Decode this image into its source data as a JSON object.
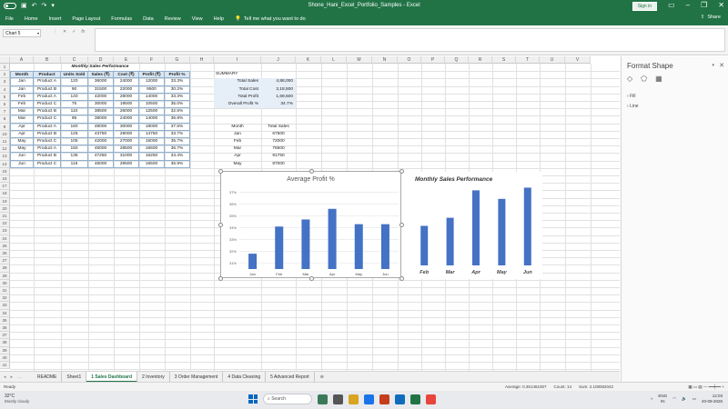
{
  "window": {
    "autosave_label": "AutoSave",
    "title": "Shone_Hani_Excel_Portfolio_Samples - Excel",
    "signin_label": "Sign in",
    "colors": {
      "accent": "#217346",
      "chart_bar": "#4472c4"
    }
  },
  "ribbon": {
    "tabs": [
      "File",
      "Home",
      "Insert",
      "Page Layout",
      "Formulas",
      "Data",
      "Review",
      "View",
      "Help"
    ],
    "tell_me": "Tell me what you want to do",
    "share": "Share"
  },
  "formula_bar": {
    "name_box": "Chart 5",
    "formula": ""
  },
  "columns": [
    "A",
    "B",
    "C",
    "D",
    "E",
    "F",
    "G",
    "H",
    "I",
    "J",
    "K",
    "L",
    "M",
    "N",
    "O",
    "P",
    "Q",
    "R",
    "S",
    "T",
    "U",
    "V"
  ],
  "rows": [
    "1",
    "2",
    "3",
    "4",
    "5",
    "6",
    "7",
    "8",
    "9",
    "10",
    "11",
    "12",
    "13",
    "14",
    "15",
    "16",
    "17",
    "18",
    "19",
    "20",
    "21",
    "22",
    "23",
    "24",
    "25",
    "26",
    "27",
    "28",
    "29",
    "30",
    "31",
    "32",
    "33",
    "34",
    "35",
    "36",
    "37",
    "38",
    "39",
    "40",
    "41"
  ],
  "table": {
    "title": "Monthly Sales Performance",
    "headers": [
      "Month",
      "Product",
      "Units Sold",
      "Sales (₹)",
      "Cost (₹)",
      "Profit (₹)",
      "Profit %"
    ],
    "rows": [
      [
        "Jan",
        "Product A",
        "120",
        "36000",
        "24000",
        "12000",
        "33.3%"
      ],
      [
        "Jan",
        "Product B",
        "90",
        "31500",
        "22000",
        "9500",
        "30.2%"
      ],
      [
        "Feb",
        "Product A",
        "140",
        "42000",
        "28000",
        "14000",
        "33.3%"
      ],
      [
        "Feb",
        "Product C",
        "75",
        "30000",
        "19500",
        "10500",
        "35.0%"
      ],
      [
        "Mar",
        "Product B",
        "110",
        "38500",
        "26000",
        "12500",
        "32.5%"
      ],
      [
        "Mar",
        "Product C",
        "95",
        "38000",
        "24000",
        "14000",
        "36.8%"
      ],
      [
        "Apr",
        "Product A",
        "160",
        "48000",
        "30000",
        "18000",
        "37.5%"
      ],
      [
        "Apr",
        "Product B",
        "125",
        "43750",
        "29000",
        "14750",
        "33.7%"
      ],
      [
        "May",
        "Product C",
        "105",
        "42000",
        "27000",
        "15000",
        "35.7%"
      ],
      [
        "May",
        "Product A",
        "150",
        "45000",
        "28500",
        "16500",
        "36.7%"
      ],
      [
        "Jun",
        "Product B",
        "135",
        "47250",
        "31000",
        "16250",
        "34.4%"
      ],
      [
        "Jun",
        "Product C",
        "115",
        "46000",
        "29500",
        "16500",
        "35.9%"
      ]
    ]
  },
  "summary": {
    "title": "SUMMARY",
    "items": [
      {
        "label": "Total Sales",
        "value": "4,88,000"
      },
      {
        "label": "Total Cost",
        "value": "3,18,500"
      },
      {
        "label": "Total Profit",
        "value": "1,69,500"
      },
      {
        "label": "Overall Profit %",
        "value": "34.7%"
      }
    ]
  },
  "monthly": {
    "headers": [
      "Month",
      "Total Sales"
    ],
    "rows": [
      [
        "Jan",
        "67500"
      ],
      [
        "Feb",
        "72000"
      ],
      [
        "Mar",
        "76500"
      ],
      [
        "Apr",
        "91750"
      ],
      [
        "May",
        "87000"
      ]
    ]
  },
  "chart_data": [
    {
      "type": "bar",
      "title": "Average Profit %",
      "categories": [
        "Jan",
        "Feb",
        "Mar",
        "Apr",
        "May",
        "Jun"
      ],
      "values": [
        31.8,
        34.1,
        34.7,
        35.6,
        34.3,
        34.3
      ],
      "y_ticks": [
        "31%",
        "32%",
        "33%",
        "34%",
        "35%",
        "36%",
        "37%"
      ],
      "ylim": [
        30.5,
        37.2
      ],
      "grid": true
    },
    {
      "type": "bar",
      "title": "Monthly Sales Performance",
      "categories": [
        "Feb",
        "Mar",
        "Apr",
        "May",
        "Jun"
      ],
      "values": [
        72000,
        76500,
        91750,
        87000,
        93250
      ],
      "ylim": [
        50000,
        95000
      ],
      "grid": false
    }
  ],
  "panel": {
    "title": "Format Shape",
    "items": [
      "Fill",
      "Line"
    ]
  },
  "sheet_tabs": {
    "tabs": [
      "README",
      "Sheet1",
      "1 Sales Dashboard",
      "2 Inventory",
      "3 Order Management",
      "4 Data Cleaning",
      "5 Advanced Report"
    ],
    "active_index": 2
  },
  "status": {
    "ready": "Ready",
    "average": "Average: 0.351461007",
    "count": "Count: 14",
    "sum": "Sum: 2.108082042"
  },
  "taskbar": {
    "temperature": "32°C",
    "condition": "Mostly cloudy",
    "search_placeholder": "Search",
    "lang": "ENG",
    "region": "IN",
    "time": "12:03",
    "date": "20-09-2026"
  }
}
